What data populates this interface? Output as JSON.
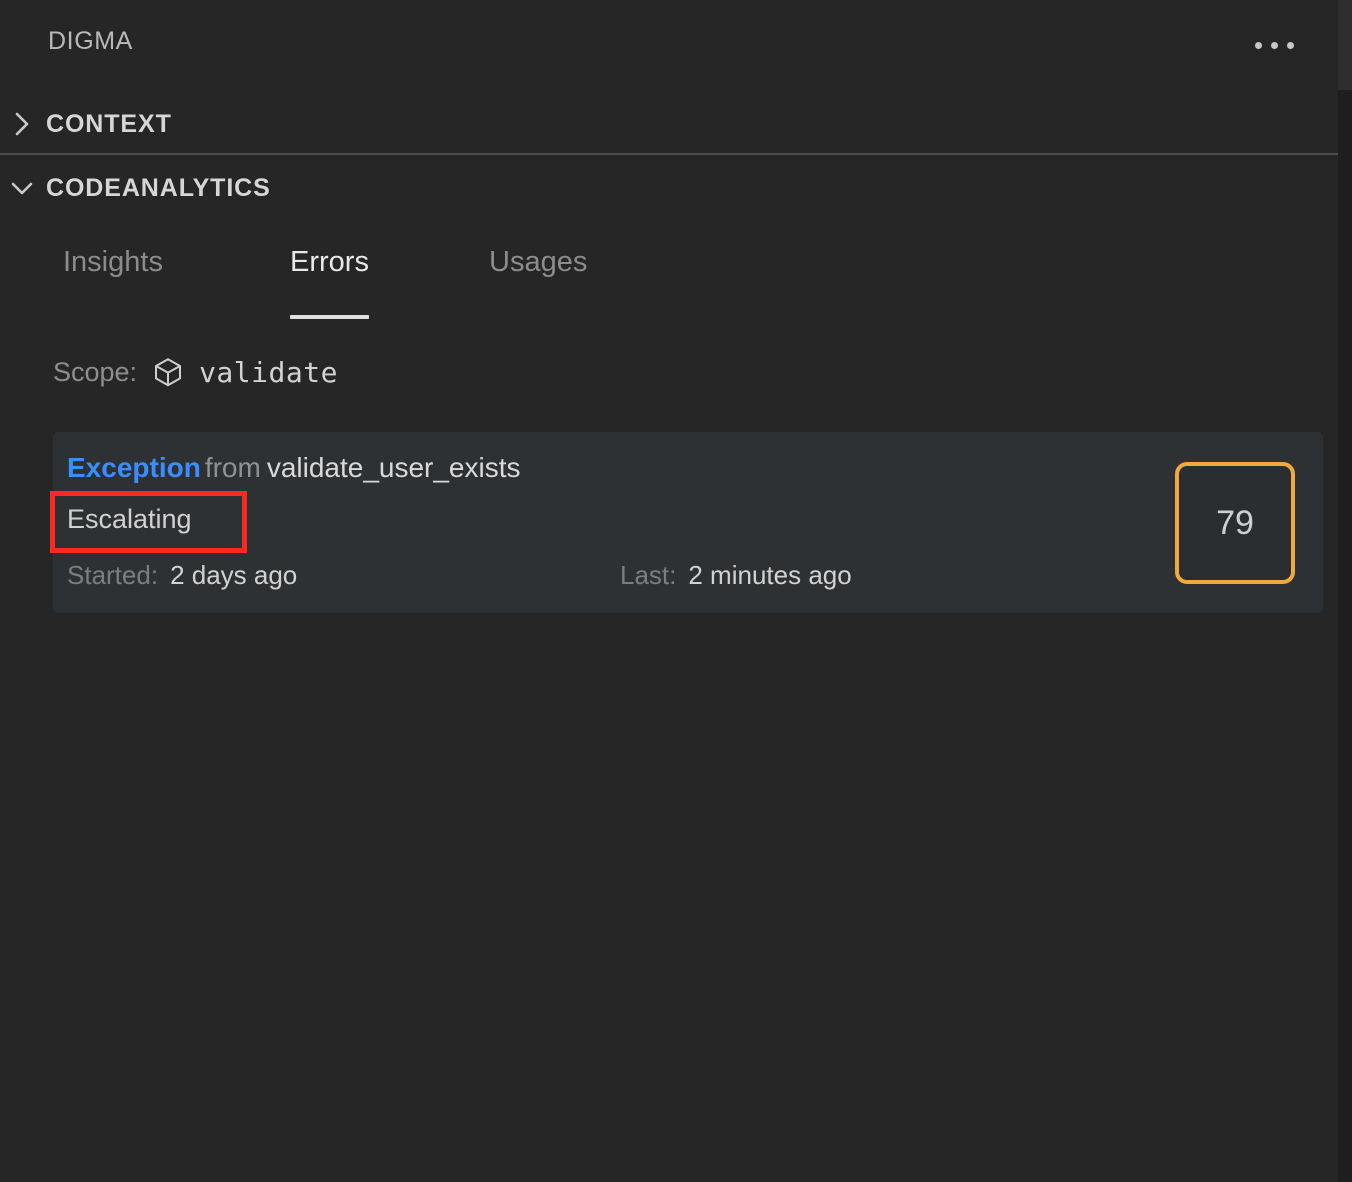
{
  "window": {
    "panel_title": "DIGMA",
    "more_menu_icon": "ellipsis-horizontal-icon"
  },
  "sections": [
    {
      "id": "context",
      "label": "CONTEXT",
      "expanded": false,
      "chevron_icon": "chevron-right-icon"
    },
    {
      "id": "codeanalytics",
      "label": "CODEANALYTICS",
      "expanded": true,
      "chevron_icon": "chevron-down-icon"
    }
  ],
  "tabs": [
    {
      "id": "insights",
      "label": "Insights",
      "active": false
    },
    {
      "id": "errors",
      "label": "Errors",
      "active": true
    },
    {
      "id": "usages",
      "label": "Usages",
      "active": false
    }
  ],
  "scope": {
    "label": "Scope:",
    "icon": "cube-icon",
    "value": "validate"
  },
  "errors": [
    {
      "type": "Exception",
      "from_label": "from",
      "source": "validate_user_exists",
      "status": "Escalating",
      "started_label": "Started:",
      "started_value": "2 days ago",
      "last_label": "Last:",
      "last_value": "2 minutes ago",
      "count": "79"
    }
  ],
  "annotation": {
    "target": "Escalating",
    "color": "#fa2a20"
  },
  "colors": {
    "background": "#262626",
    "card_background": "#2e3133",
    "accent_link": "#3b8dfc",
    "badge_border": "#f0a93b",
    "muted_text": "#8c8c8c",
    "primary_text": "#d4d4d4",
    "divider": "#4b4b4b",
    "tab_underline": "#e0e0e0",
    "annotation": "#fa2a20"
  }
}
